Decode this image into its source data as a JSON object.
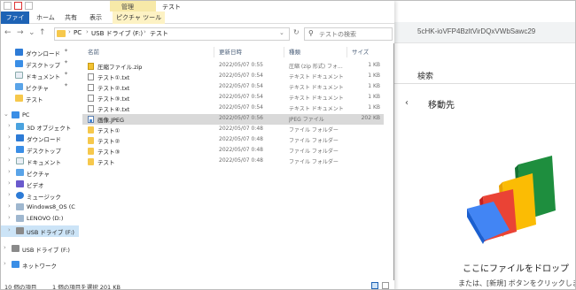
{
  "window": {
    "title": "テスト",
    "manage_tab": "管理"
  },
  "ribbon": {
    "tabs": [
      "ファイル",
      "ホーム",
      "共有",
      "表示",
      "ピクチャ ツール"
    ]
  },
  "address": {
    "crumbs": [
      "PC",
      "USB ドライブ (F:)",
      "テスト"
    ],
    "search_placeholder": "テストの検索"
  },
  "nav": {
    "items": [
      {
        "label": "ダウンロード",
        "pinned": true
      },
      {
        "label": "デスクトップ",
        "pinned": true
      },
      {
        "label": "ドキュメント",
        "pinned": true
      },
      {
        "label": "ピクチャ",
        "pinned": true
      },
      {
        "label": "テスト",
        "pinned": false
      },
      {
        "label": "PC",
        "pinned": false
      },
      {
        "label": "3D オブジェクト",
        "pinned": false
      },
      {
        "label": "ダウンロード",
        "pinned": false
      },
      {
        "label": "デスクトップ",
        "pinned": false
      },
      {
        "label": "ドキュメント",
        "pinned": false
      },
      {
        "label": "ピクチャ",
        "pinned": false
      },
      {
        "label": "ビデオ",
        "pinned": false
      },
      {
        "label": "ミュージック",
        "pinned": false
      },
      {
        "label": "Windows8_OS (C",
        "pinned": false
      },
      {
        "label": "LENOVO (D:)",
        "pinned": false
      },
      {
        "label": "USB ドライブ (F:)",
        "pinned": false
      },
      {
        "label": "USB ドライブ (F:)",
        "pinned": false
      },
      {
        "label": "ネットワーク",
        "pinned": false
      }
    ]
  },
  "columns": [
    "名前",
    "更新日時",
    "種類",
    "サイズ"
  ],
  "files": [
    {
      "name": "圧縮ファイル.zip",
      "date": "2022/05/07 0:55",
      "type": "圧縮 (zip 形式) フォ...",
      "size": "1 KB",
      "kind": "zip"
    },
    {
      "name": "テスト①.txt",
      "date": "2022/05/07 0:54",
      "type": "テキスト ドキュメント",
      "size": "1 KB",
      "kind": "txt"
    },
    {
      "name": "テスト②.txt",
      "date": "2022/05/07 0:54",
      "type": "テキスト ドキュメント",
      "size": "1 KB",
      "kind": "txt"
    },
    {
      "name": "テスト③.txt",
      "date": "2022/05/07 0:54",
      "type": "テキスト ドキュメント",
      "size": "1 KB",
      "kind": "txt"
    },
    {
      "name": "テスト④.txt",
      "date": "2022/05/07 0:54",
      "type": "テキスト ドキュメント",
      "size": "1 KB",
      "kind": "txt"
    },
    {
      "name": "画像.JPEG",
      "date": "2022/05/07 0:56",
      "type": "JPEG ファイル",
      "size": "202 KB",
      "kind": "jpeg",
      "selected": true
    },
    {
      "name": "テスト①",
      "date": "2022/05/07 0:48",
      "type": "ファイル フォルダー",
      "size": "",
      "kind": "folder"
    },
    {
      "name": "テスト②",
      "date": "2022/05/07 0:48",
      "type": "ファイル フォルダー",
      "size": "",
      "kind": "folder"
    },
    {
      "name": "テスト③",
      "date": "2022/05/07 0:48",
      "type": "ファイル フォルダー",
      "size": "",
      "kind": "folder"
    },
    {
      "name": "テスト",
      "date": "2022/05/07 0:48",
      "type": "ファイル フォルダー",
      "size": "",
      "kind": "folder"
    }
  ],
  "status": {
    "count": "10 個の項目",
    "selection": "1 個の項目を選択  201 KB"
  },
  "web": {
    "url_fragment": "5cHK-ioVFP4BzltVirDQxVWbSawc29",
    "search_label": "検索",
    "move_label": "移動先",
    "drop_title": "ここにファイルをドロップ",
    "drop_sub": "または、[新規] ボタンをクリックします。"
  }
}
